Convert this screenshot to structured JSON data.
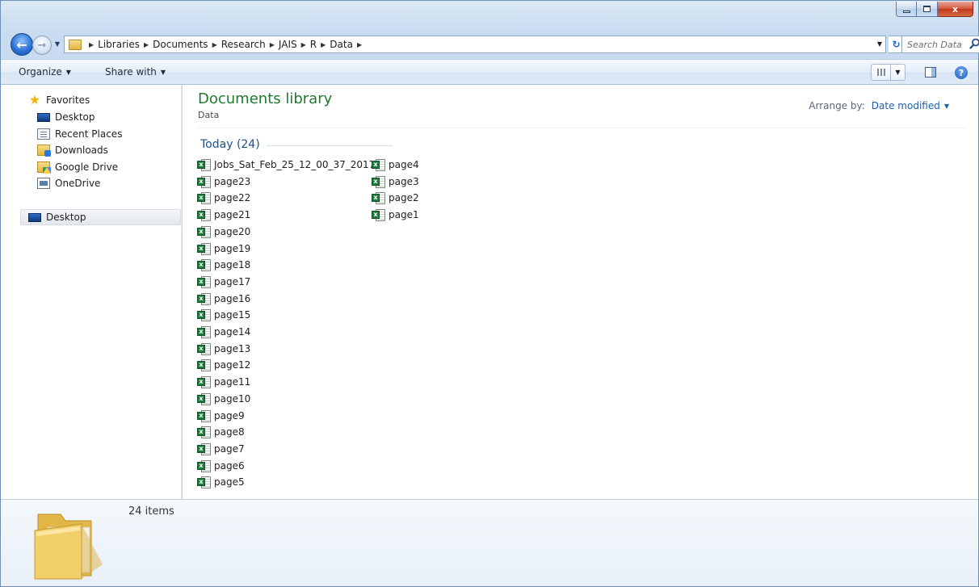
{
  "window": {
    "caption_buttons": {
      "minimize_icon": "minimize-icon",
      "maximize_icon": "maximize-icon",
      "close_glyph": "x"
    }
  },
  "address": {
    "crumbs": [
      "Libraries",
      "Documents",
      "Research",
      "JAIS",
      "R",
      "Data"
    ]
  },
  "search": {
    "placeholder": "Search Data"
  },
  "toolbar": {
    "organize_label": "Organize",
    "share_label": "Share with"
  },
  "sidebar": {
    "favorites_label": "Favorites",
    "items": [
      {
        "label": "Desktop",
        "icon": "desktop-icon"
      },
      {
        "label": "Recent Places",
        "icon": "recent-places-icon"
      },
      {
        "label": "Downloads",
        "icon": "downloads-folder-icon"
      },
      {
        "label": "Google Drive",
        "icon": "google-drive-folder-icon"
      },
      {
        "label": "OneDrive",
        "icon": "onedrive-icon"
      }
    ],
    "desktop_root_label": "Desktop"
  },
  "content": {
    "library_title": "Documents library",
    "library_subtitle": "Data",
    "arrange_label": "Arrange by:",
    "arrange_value": "Date modified",
    "group_label": "Today (24)",
    "files": [
      "Jobs_Sat_Feb_25_12_00_37_2017",
      "page23",
      "page22",
      "page21",
      "page20",
      "page19",
      "page18",
      "page17",
      "page16",
      "page15",
      "page14",
      "page13",
      "page12",
      "page11",
      "page10",
      "page9",
      "page8",
      "page7",
      "page6",
      "page5",
      "page4",
      "page3",
      "page2",
      "page1"
    ]
  },
  "details": {
    "item_count": "24 items"
  },
  "colors": {
    "library_title": "#1f7a2f",
    "link_blue": "#1a5fb4",
    "excel_green": "#1e7a3c"
  }
}
